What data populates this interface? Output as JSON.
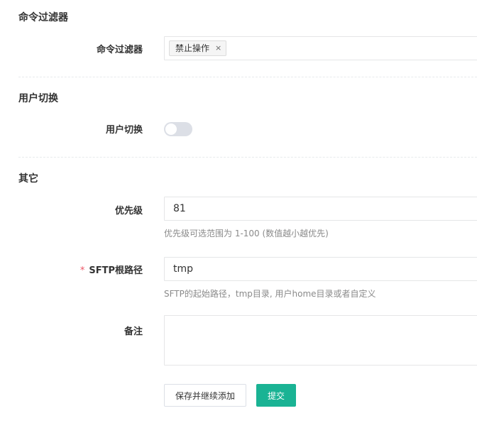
{
  "sections": {
    "command_filter": {
      "title": "命令过滤器",
      "label": "命令过滤器",
      "tags": [
        {
          "label": "禁止操作",
          "remove": "×"
        }
      ]
    },
    "user_switch": {
      "title": "用户切换",
      "label": "用户切换",
      "enabled": false
    },
    "other": {
      "title": "其它",
      "priority": {
        "label": "优先级",
        "value": "81",
        "hint": "优先级可选范围为 1-100 (数值越小越优先)"
      },
      "sftp_root": {
        "required_mark": "*",
        "label": "SFTP根路径",
        "value": "tmp",
        "hint": "SFTP的起始路径，tmp目录, 用户home目录或者自定义"
      },
      "note": {
        "label": "备注",
        "value": ""
      }
    }
  },
  "actions": {
    "save_continue": "保存并继续添加",
    "submit": "提交"
  },
  "colors": {
    "primary": "#1ab394",
    "required": "#ed5565",
    "switch_off": "#dcdfe6"
  }
}
